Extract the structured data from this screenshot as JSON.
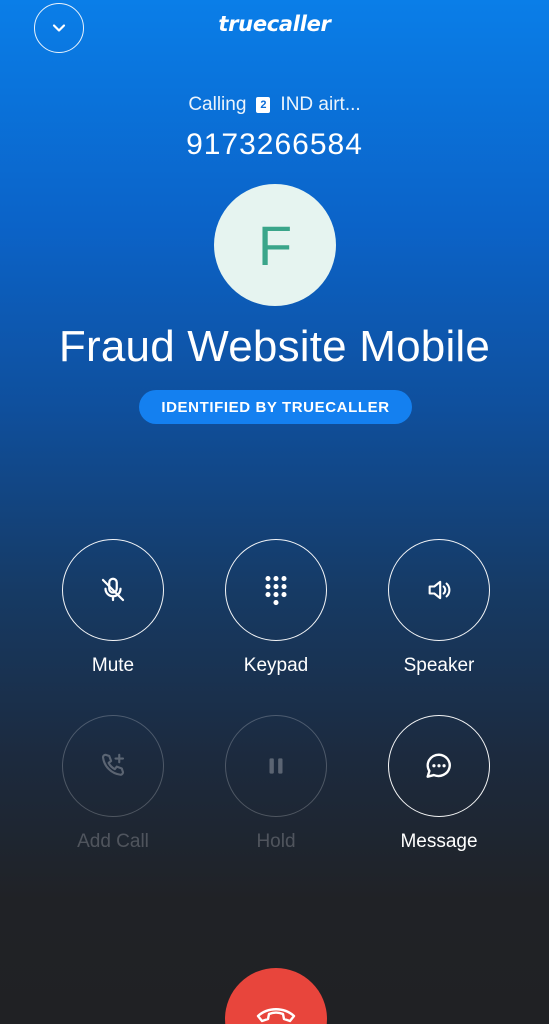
{
  "app": {
    "brand": "truecaller"
  },
  "call": {
    "status_prefix": "Calling",
    "sim_slot": "2",
    "carrier": "IND airt...",
    "number": "9173266584",
    "avatar_letter": "F",
    "caller_name": "Fraud Website Mobile",
    "identified_label": "IDENTIFIED BY TRUECALLER"
  },
  "controls": {
    "mute": "Mute",
    "keypad": "Keypad",
    "speaker": "Speaker",
    "add_call": "Add Call",
    "hold": "Hold",
    "message": "Message"
  },
  "icons": {
    "collapse": "chevron-down-icon",
    "mute": "mic-off-icon",
    "keypad": "dialpad-icon",
    "speaker": "speaker-icon",
    "add_call": "phone-add-icon",
    "hold": "pause-icon",
    "message": "chat-bubble-icon",
    "end_call": "phone-hangup-icon"
  },
  "colors": {
    "gradient_top": "#0a7ee8",
    "gradient_bottom": "#202124",
    "badge_blue": "#1480f0",
    "end_call_red": "#e8453c",
    "avatar_bg": "#e6f4f0",
    "avatar_letter": "#3aa58a"
  }
}
